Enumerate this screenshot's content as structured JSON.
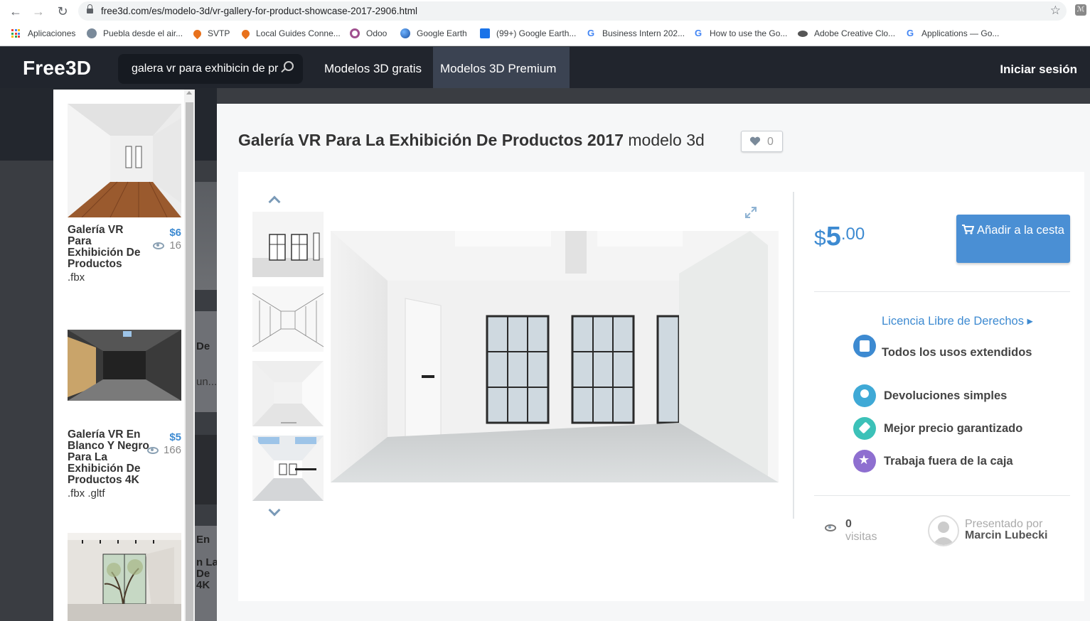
{
  "browser": {
    "url": "free3d.com/es/modelo-3d/vr-gallery-for-product-showcase-2017-2906.html",
    "bookmarks": [
      {
        "label": "Aplicaciones",
        "icon": "apps-grid-icon"
      },
      {
        "label": "Puebla desde el air...",
        "icon": "globe-icon"
      },
      {
        "label": "SVTP",
        "icon": "map-pin-icon"
      },
      {
        "label": "Local Guides Conne...",
        "icon": "map-pin-icon"
      },
      {
        "label": "Odoo",
        "icon": "odoo-icon"
      },
      {
        "label": "Google Earth",
        "icon": "google-earth-icon"
      },
      {
        "label": "(99+) Google Earth...",
        "icon": "chat-icon"
      },
      {
        "label": "Business Intern 202...",
        "icon": "google-icon"
      },
      {
        "label": "How to use the Go...",
        "icon": "google-icon"
      },
      {
        "label": "Adobe Creative Clo...",
        "icon": "adobe-icon"
      },
      {
        "label": "Applications — Go...",
        "icon": "google-icon"
      }
    ]
  },
  "header": {
    "logo": "Free3D",
    "search_value": "galera vr para exhibicin de pr",
    "nav": [
      "Modelos 3D gratis",
      "Modelos 3D Premium"
    ],
    "login": "Iniciar sesión"
  },
  "dropdown": {
    "results": [
      {
        "title": "Galería VR Para Exhibición De Productos",
        "price": "$6",
        "views": "16",
        "formats": ".fbx"
      },
      {
        "title": "Galería VR En Blanco Y Negro Para La Exhibición De Productos 4K",
        "price": "$5",
        "views": "166",
        "formats": ".fbx .gltf"
      }
    ]
  },
  "background_fragments": [
    "De",
    "un...",
    "En",
    "n La",
    "De",
    "4K"
  ],
  "product": {
    "title_bold": "Galería VR Para La Exhibición De Productos 2017",
    "title_suffix": "modelo 3d",
    "likes": "0",
    "price_currency": "$",
    "price_int": "5",
    "price_dec": ".00",
    "cart_label": "Añadir a la cesta",
    "license_link": "Licencia Libre de Derechos ▸",
    "license_sub": "Todos los usos extendidos",
    "features": [
      {
        "label": "Devoluciones simples",
        "icon": "user-return-icon",
        "color": "#3fa9d6"
      },
      {
        "label": "Mejor precio garantizado",
        "icon": "price-tag-icon",
        "color": "#3cc1b8"
      },
      {
        "label": "Trabaja fuera de la caja",
        "icon": "star-icon",
        "color": "#8e6fd0"
      }
    ],
    "license_icon_color": "#3d8ad1",
    "views_count": "0",
    "views_label": "visitas",
    "presented_by": "Presentado por",
    "author": "Marcin Lubecki"
  },
  "colors": {
    "accent": "#3d8ad1",
    "header_bg": "#21252d"
  }
}
